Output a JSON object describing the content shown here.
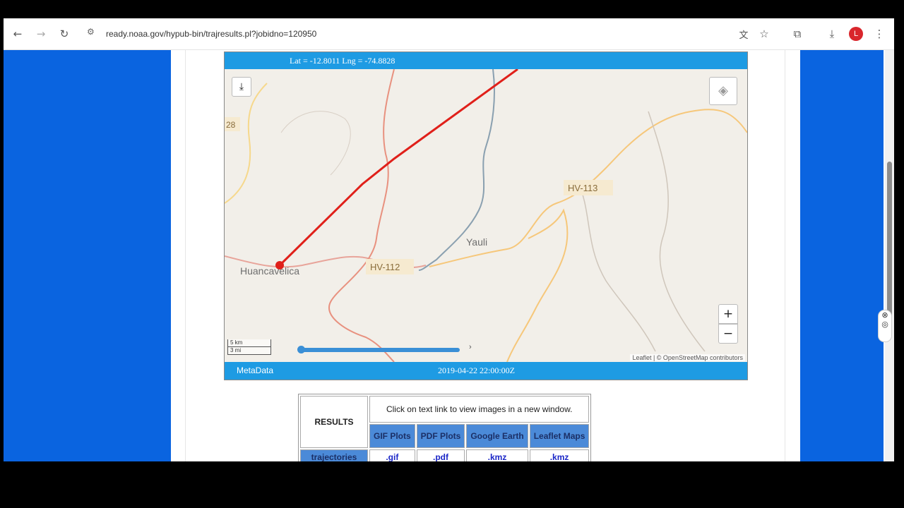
{
  "browser": {
    "url": "ready.noaa.gov/hypub-bin/trajresults.pl?jobidno=120950",
    "avatar_letter": "L",
    "icons": [
      "back-icon",
      "forward-icon",
      "reload-icon",
      "site-info-icon",
      "translate-icon",
      "bookmark-star-icon",
      "extensions-icon",
      "download-icon",
      "menu-icon"
    ]
  },
  "map": {
    "coords": "Lat = -12.8011 Lng = -74.8828",
    "metadata_label": "MetaData",
    "timestamp": "2019-04-22 22:00:00Z",
    "attribution": "Leaflet | © OpenStreetMap contributors",
    "scale_km": "5 km",
    "scale_mi": "3 mi",
    "zoom_in": "+",
    "zoom_out": "−",
    "labels": {
      "road_28": "28",
      "hv113": "HV-113",
      "yauli": "Yauli",
      "hv112": "HV-112",
      "huancavelica": "Huancavelica"
    }
  },
  "results": {
    "title": "RESULTS",
    "note": "Click on text link to view images in a new window.",
    "columns": [
      "GIF Plots",
      "PDF Plots",
      "Google Earth",
      "Leaflet Maps"
    ],
    "row_label": "trajectories",
    "row_links": [
      ".gif",
      ".pdf",
      ".kmz",
      ".kmz"
    ]
  },
  "colors": {
    "page_blue": "#0a64e0",
    "map_header": "#1e9be3",
    "trajectory": "#e0201a"
  }
}
